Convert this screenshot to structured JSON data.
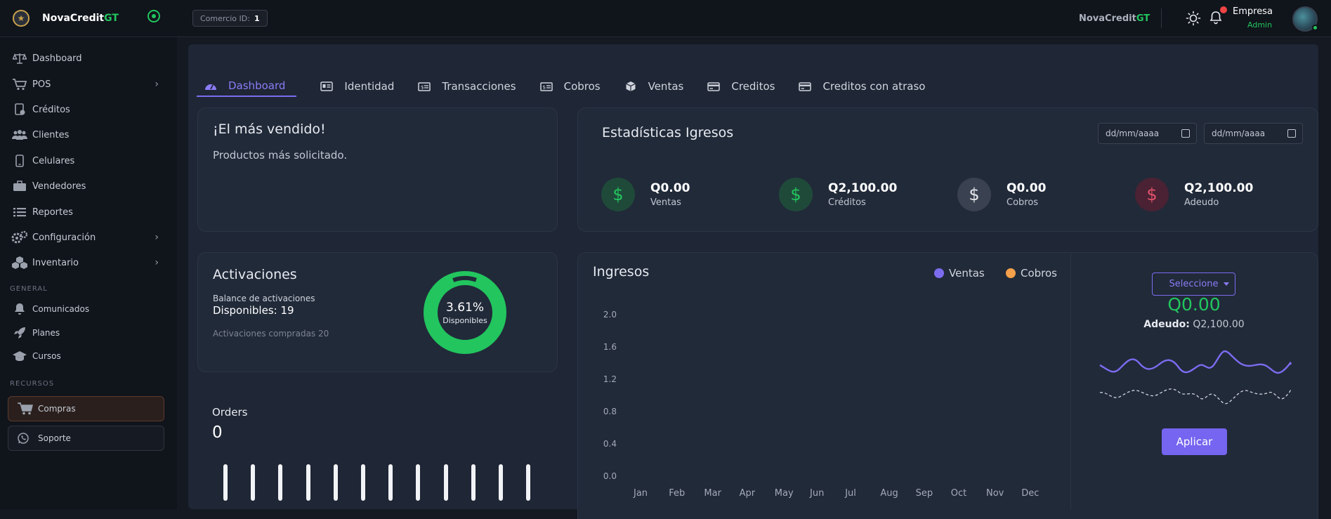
{
  "topbar": {
    "brand_main": "NovaCredit",
    "brand_suffix": "GT",
    "comercio_label": "Comercio ID",
    "comercio_value": "1",
    "right_brand_main": "NovaCredit",
    "right_brand_suffix": "GT",
    "user_name": "Empresa",
    "user_role": "Admin"
  },
  "sidebar": {
    "items": [
      {
        "label": "Dashboard",
        "icon": "scale-icon"
      },
      {
        "label": "POS",
        "icon": "cart-icon"
      },
      {
        "label": "Créditos",
        "icon": "credit-doc-icon"
      },
      {
        "label": "Clientes",
        "icon": "users-icon"
      },
      {
        "label": "Celulares",
        "icon": "phone-icon"
      },
      {
        "label": "Vendedores",
        "icon": "briefcase-icon"
      },
      {
        "label": "Reportes",
        "icon": "list-icon"
      },
      {
        "label": "Configuración",
        "icon": "gears-icon"
      },
      {
        "label": "Inventario",
        "icon": "boxes-icon"
      }
    ],
    "section_general": "GENERAL",
    "general_items": [
      {
        "label": "Comunicados",
        "icon": "bell-icon"
      },
      {
        "label": "Planes",
        "icon": "rocket-icon"
      },
      {
        "label": "Cursos",
        "icon": "graduation-cap-icon"
      }
    ],
    "section_recursos": "RECURSOS",
    "compras_label": "Compras",
    "soporte_label": "Soporte"
  },
  "tabs": [
    {
      "label": "Dashboard",
      "icon": "gauge-icon"
    },
    {
      "label": "Identidad",
      "icon": "id-card-icon"
    },
    {
      "label": "Transacciones",
      "icon": "money-bill-icon"
    },
    {
      "label": "Cobros",
      "icon": "cash-icon"
    },
    {
      "label": "Ventas",
      "icon": "box-icon"
    },
    {
      "label": "Creditos",
      "icon": "credit-card-icon"
    },
    {
      "label": "Creditos con atraso",
      "icon": "credit-card-late-icon"
    }
  ],
  "best_seller": {
    "title": "¡El más vendido!",
    "subtitle": "Productos más solicitado."
  },
  "income_stats": {
    "title": "Estadísticas Igresos",
    "date_placeholder_1": "dd/mm/aaaa",
    "date_placeholder_2": "dd/mm/aaaa",
    "stats": [
      {
        "value": "Q0.00",
        "label": "Ventas",
        "color": "#22c55e"
      },
      {
        "value": "Q2,100.00",
        "label": "Créditos",
        "color": "#22c55e"
      },
      {
        "value": "Q0.00",
        "label": "Cobros",
        "color": "#e5e7eb"
      },
      {
        "value": "Q2,100.00",
        "label": "Adeudo",
        "color": "#e0526b"
      }
    ]
  },
  "activations": {
    "title": "Activaciones",
    "balance_label": "Balance de activaciones",
    "available": "Disponibles: 19",
    "purchased": "Activaciones compradas 20",
    "donut_percent": "3.61%",
    "donut_label": "Disponibles",
    "donut_fraction": 0.0361
  },
  "orders": {
    "title": "Orders",
    "value": "0",
    "bar_count": 12
  },
  "chart_data": {
    "type": "line",
    "title": "Ingresos",
    "categories": [
      "Jan",
      "Feb",
      "Mar",
      "Apr",
      "May",
      "Jun",
      "Jul",
      "Aug",
      "Sep",
      "Oct",
      "Nov",
      "Dec"
    ],
    "series": [
      {
        "name": "Ventas",
        "color": "#7c6cf0",
        "values": []
      },
      {
        "name": "Cobros",
        "color": "#f5a04a",
        "values": []
      }
    ],
    "y_ticks": [
      "2.0",
      "1.6",
      "1.2",
      "0.8",
      "0.4",
      "0.0"
    ],
    "ylim": [
      0,
      2.0
    ],
    "grid": false,
    "legend_position": "top-right"
  },
  "side_panel": {
    "select_label": "Seleccione",
    "amount": "Q0.00",
    "adeudo_label": "Adeudo:",
    "adeudo_value": "Q2,100.00",
    "apply_label": "Aplicar"
  }
}
